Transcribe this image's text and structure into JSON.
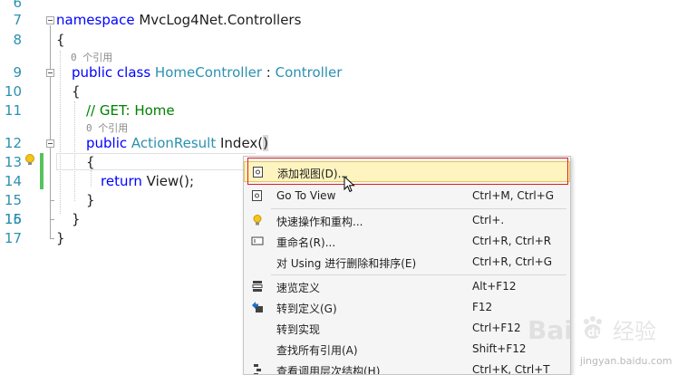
{
  "line_numbers": [
    "6",
    "7",
    "8",
    "",
    "9",
    "10",
    "11",
    "",
    "12",
    "13",
    "14",
    "15",
    "16",
    "17"
  ],
  "code": {
    "l7_kw": "namespace",
    "l7_name": " MvcLog4Net.Controllers",
    "l8": "{",
    "lens_class": "0 个引用",
    "l9_kw1": "public",
    "l9_kw2": " class",
    "l9_type": " HomeController",
    "l9_colon": " : ",
    "l9_base": "Controller",
    "l10": "{",
    "l11_comment": "// GET: Home",
    "lens_method": "0 个引用",
    "l12_kw": "public",
    "l12_type": " ActionResult",
    "l12_name": " Index(",
    "l12_paren": ")",
    "l13": "{",
    "l14_kw": "return",
    "l14_rest": " View();",
    "l15": "}",
    "l16": "}",
    "l17": "}"
  },
  "context_menu": {
    "items": [
      {
        "label": "添加视图(D)...",
        "shortcut": "",
        "icon": "add-view-icon",
        "highlighted": true
      },
      {
        "label": "Go To View",
        "shortcut": "Ctrl+M, Ctrl+G",
        "icon": "go-to-view-icon"
      },
      {
        "label": "快速操作和重构...",
        "shortcut": "Ctrl+.",
        "icon": "lightbulb-icon"
      },
      {
        "label": "重命名(R)...",
        "shortcut": "Ctrl+R, Ctrl+R",
        "icon": "rename-icon"
      },
      {
        "label": "对 Using 进行删除和排序(E)",
        "shortcut": "Ctrl+R, Ctrl+G",
        "icon": ""
      },
      {
        "label": "速览定义",
        "shortcut": "Alt+F12",
        "icon": "peek-definition-icon"
      },
      {
        "label": "转到定义(G)",
        "shortcut": "F12",
        "icon": "go-to-definition-icon"
      },
      {
        "label": "转到实现",
        "shortcut": "Ctrl+F12",
        "icon": ""
      },
      {
        "label": "查找所有引用(A)",
        "shortcut": "Shift+F12",
        "icon": ""
      },
      {
        "label": "查看调用层次结构(H)",
        "shortcut": "Ctrl+K, Ctrl+T",
        "icon": "call-hierarchy-icon"
      }
    ]
  },
  "watermark": {
    "brand": "Bai",
    "brand2": "du",
    "brand_cn": "经验",
    "site": "jingyan.baidu.com"
  },
  "colors": {
    "keyword": "#0000ff",
    "type": "#2b91af",
    "comment": "#008000",
    "highlight": "#fdf4bf",
    "red_box": "#e02020"
  }
}
